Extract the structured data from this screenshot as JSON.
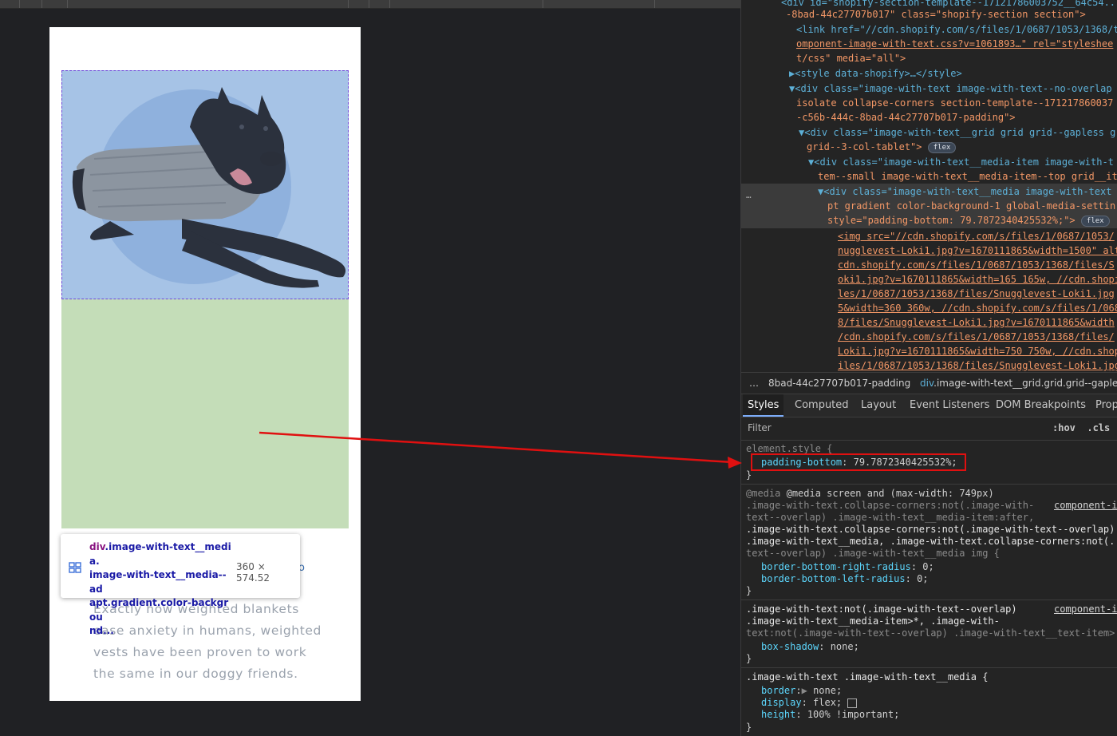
{
  "viewport": {
    "body_text_lines": [
      "Exactly how weighted blankets",
      "ease anxiety in humans, weighted",
      "vests have been proven to work",
      "the same in our doggy friends."
    ],
    "partial_char": "o"
  },
  "tooltip": {
    "element_name": "div",
    "element_classes": ".image-with-text__media.",
    "element_classes_2": "image-with-text__media--ad",
    "element_classes_3": "apt.gradient.color-backgrou",
    "element_classes_4": "nd...",
    "size": "360 × 574.52"
  },
  "dom": {
    "lines": [
      {
        "t": "<div id=\"shopify-section-template--17121786003752__64c54..."
      },
      {
        "t": "-8bad-44c27707b017\" class=\"shopify-section section\">"
      },
      {
        "t": "<link href=\"//cdn.shopify.com/s/files/1/0687/1053/1368/t"
      },
      {
        "t": "omponent-image-with-text.css?v=1061893…\" rel=\"styleshee"
      },
      {
        "t": "t/css\" media=\"all\">"
      },
      {
        "t": "▶<style data-shopify>…</style>"
      },
      {
        "t": "▼<div class=\"image-with-text image-with-text--no-overlap"
      },
      {
        "t": "isolate collapse-corners section-template--171217860037"
      },
      {
        "t": "-c56b-444c-8bad-44c27707b017-padding\">"
      },
      {
        "t": "▼<div class=\"image-with-text__grid grid grid--gapless g"
      },
      {
        "t": "grid--3-col-tablet\">"
      },
      {
        "t": "▼<div class=\"image-with-text__media-item image-with-t"
      },
      {
        "t": "tem--small image-with-text__media-item--top grid__it"
      },
      {
        "t": "▼<div class=\"image-with-text__media image-with-text"
      },
      {
        "t": "pt gradient color-background-1 global-media-settin"
      },
      {
        "t": "style=\"padding-bottom: 79.7872340425532%;\">"
      },
      {
        "t": "<img src=\"//cdn.shopify.com/s/files/1/0687/1053/"
      },
      {
        "t": "nugglevest-Loki1.jpg?v=1670111865&width=1500\" alt"
      },
      {
        "t": "cdn.shopify.com/s/files/1/0687/1053/1368/files/S"
      },
      {
        "t": "oki1.jpg?v=1670111865&width=165 165w, //cdn.shopi"
      },
      {
        "t": "les/1/0687/1053/1368/files/Snugglevest-Loki1.jpg"
      },
      {
        "t": "5&width=360 360w, //cdn.shopify.com/s/files/1/068"
      },
      {
        "t": "8/files/Snugglevest-Loki1.jpg?v=1670111865&width"
      },
      {
        "t": "/cdn.shopify.com/s/files/1/0687/1053/1368/files/"
      },
      {
        "t": "Loki1.jpg?v=1670111865&width=750 750w, //cdn.shop"
      },
      {
        "t": "iles/1/0687/1053/1368/files/Snugglevest-Loki1.jpg"
      }
    ],
    "badge_flex": "flex",
    "ellipsis": "…"
  },
  "breadcrumb": {
    "dots": "…",
    "item1": "8bad-44c27707b017-padding",
    "item2_tag": "div",
    "item2_cls": ".image-with-text__grid.grid.grid--gaples"
  },
  "tabs": [
    "Styles",
    "Computed",
    "Layout",
    "Event Listeners",
    "DOM Breakpoints",
    "Prop"
  ],
  "filter": {
    "placeholder": "Filter",
    "hov": ":hov",
    "cls": ".cls"
  },
  "styles": {
    "element_style_open": "element.style {",
    "pb_prop": "padding-bottom",
    "pb_val": "79.7872340425532%;",
    "close": "}",
    "media_line": "@media screen and (max-width: 749px)",
    "r1_sel1": ".image-with-text.collapse-corners:not(.image-with-",
    "r1_sel2": "text--overlap) .image-with-text__media-item:after,",
    "r1_sel3": ".image-with-text.collapse-corners:not(.image-with-text--overlap)",
    "r1_sel4": ".image-with-text__media, .image-with-text.collapse-corners:not(.",
    "r1_sel5": "text--overlap) .image-with-text__media img {",
    "r1_src": "component-i",
    "r1_p1": "border-bottom-right-radius",
    "r1_v1": "0;",
    "r1_p2": "border-bottom-left-radius",
    "r1_v2": "0;",
    "r2_sel1": ".image-with-text:not(.image-with-text--overlap)",
    "r2_sel2": ".image-with-text__media-item>*, .image-with-",
    "r2_sel3": "text:not(.image-with-text--overlap) .image-with-text__text-item>",
    "r2_src": "component-i",
    "r2_p1": "box-shadow",
    "r2_v1": "none;",
    "r3_sel": ".image-with-text .image-with-text__media {",
    "r3_p1": "border",
    "r3_v1": "none;",
    "r3_p2": "display",
    "r3_v2": "flex;",
    "r3_p3": "height",
    "r3_v3": "100% !important;"
  },
  "colors": {
    "image_bg": "#a6c3e6",
    "padding_bg": "#c4ddb8",
    "highlight": "#e01010"
  }
}
